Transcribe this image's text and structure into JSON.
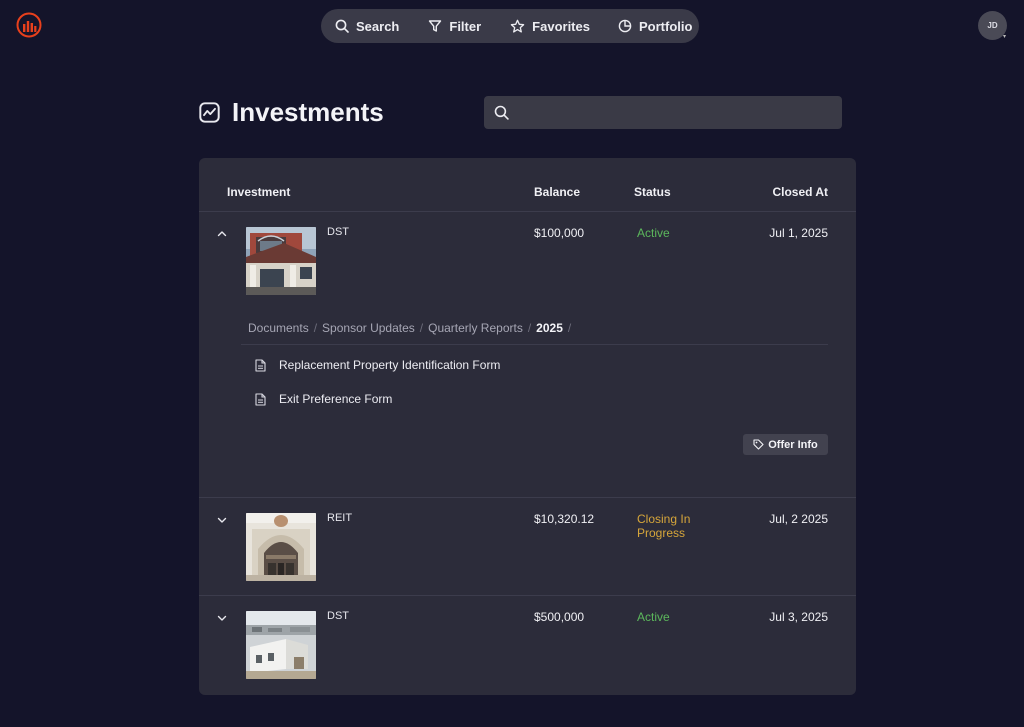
{
  "nav": {
    "search": "Search",
    "filter": "Filter",
    "favorites": "Favorites",
    "portfolio": "Portfolio"
  },
  "user": {
    "initials": "JD"
  },
  "page": {
    "title": "Investments"
  },
  "search": {
    "placeholder": "",
    "value": ""
  },
  "table": {
    "headers": {
      "investment": "Investment",
      "balance": "Balance",
      "status": "Status",
      "closed_at": "Closed At"
    },
    "rows": [
      {
        "type": "DST",
        "balance": "$100,000",
        "status": "Active",
        "closed_at": "Jul 1, 2025"
      },
      {
        "type": "REIT",
        "balance": "$10,320.12",
        "status": "Closing In Progress",
        "closed_at": "Jul, 2 2025"
      },
      {
        "type": "DST",
        "balance": "$500,000",
        "status": "Active",
        "closed_at": "Jul 3, 2025"
      }
    ]
  },
  "expanded": {
    "breadcrumb": [
      "Documents",
      "Sponsor Updates",
      "Quarterly Reports",
      "2025"
    ],
    "documents": [
      "Replacement Property Identification Form",
      "Exit Preference Form"
    ],
    "offer_button": "Offer Info"
  },
  "colors": {
    "background": "#14142a",
    "panel": "#2c2c3a",
    "active": "#5cb85c",
    "in_progress": "#d6a63a",
    "brand": "#e8401c"
  },
  "icons": {
    "logo": "bar-chart-logo-icon",
    "search": "search-icon",
    "filter": "filter-icon",
    "favorites": "star-icon",
    "portfolio": "pie-chart-icon",
    "page": "trend-line-icon",
    "document": "document-icon",
    "offer": "tag-icon",
    "collapse": "chevron-up-icon",
    "expand": "chevron-down-icon"
  }
}
